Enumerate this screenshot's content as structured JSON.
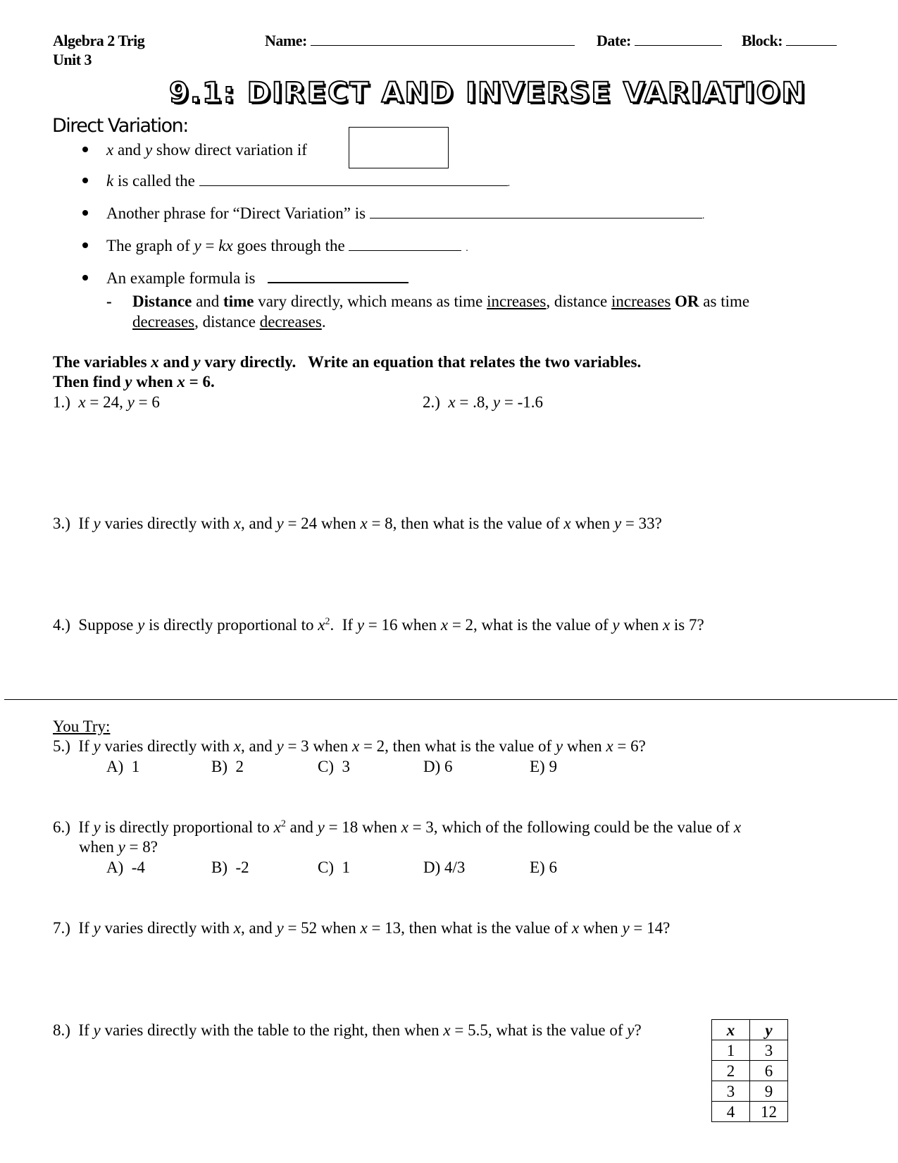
{
  "header": {
    "course": "Algebra 2 Trig",
    "unit": "Unit 3",
    "name_label": "Name:",
    "date_label": "Date:",
    "block_label": "Block:"
  },
  "title": "9.1: DIRECT AND INVERSE VARIATION",
  "direct_variation": {
    "heading": "Direct Variation:",
    "bullets": [
      {
        "pre_var1": "x",
        "text1": " and ",
        "pre_var2": "y",
        "text2": " show direct variation if"
      },
      {
        "var": "k",
        "text": " is called the",
        "end": "."
      },
      {
        "text": "Another phrase for “Direct Variation” is",
        "end": "."
      },
      {
        "text1": "The graph of ",
        "eq": "y",
        "eq_mid": " = ",
        "eq2": "kx",
        "text2": " goes through the",
        "end": "."
      },
      {
        "text": "An example formula is"
      }
    ],
    "sub_bullet": {
      "dash": "-",
      "w1": "Distance",
      "t1": " and ",
      "w2": "time",
      "t2": " vary directly, which means as time ",
      "u1": "increases",
      "t3": ", distance ",
      "u2": "increases",
      "t4": " ",
      "w3": "OR",
      "t5": " as time",
      "u3": "decreases",
      "t6": ", distance ",
      "u4": "decreases",
      "t7": "."
    }
  },
  "instructions": {
    "line1_a": "The variables ",
    "line1_x": "x",
    "line1_b": " and ",
    "line1_y": "y",
    "line1_c": " vary directly.   Write an equation that relates the two variables.",
    "line2_a": "Then find ",
    "line2_y": "y",
    "line2_b": " when ",
    "line2_x": "x",
    "line2_c": " = 6."
  },
  "problems": {
    "p1": {
      "num": "1.)",
      "x": "x",
      "xv": " = 24, ",
      "y": "y",
      "yv": " = 6"
    },
    "p2": {
      "num": "2.)",
      "x": "x",
      "xv": " = .8, ",
      "y": "y",
      "yv": " = -1.6"
    },
    "p3": {
      "num": "3.)",
      "a": "If ",
      "y1": "y",
      "b": " varies directly with ",
      "x1": "x",
      "c": ", and ",
      "y2": "y",
      "d": " = 24 when ",
      "x2": "x",
      "e": " = 8, then what is the value of ",
      "x3": "x",
      "f": " when ",
      "y3": "y",
      "g": " = 33?"
    },
    "p4": {
      "num": "4.)",
      "a": "Suppose ",
      "y1": "y",
      "b": " is directly proportional to ",
      "x1": "x",
      "sup": "2",
      "c": ".  If ",
      "y2": "y",
      "d": " = 16 when ",
      "x2": "x",
      "e": " = 2, what is the value of ",
      "y3": "y",
      "f": " when ",
      "x3": "x",
      "g": " is 7?"
    }
  },
  "you_try": {
    "heading": "You Try:",
    "p5": {
      "num": "5.)",
      "a": "If ",
      "y1": "y",
      "b": " varies directly with ",
      "x1": "x",
      "c": ", and ",
      "y2": "y",
      "d": " = 3 when ",
      "x2": "x",
      "e": " = 2, then what is the value of ",
      "y3": "y",
      "f": " when ",
      "x3": "x",
      "g": " = 6?",
      "choices": [
        "A)  1",
        "B)  2",
        "C)  3",
        "D) 6",
        "E) 9"
      ]
    },
    "p6": {
      "num": "6.)",
      "a": "If ",
      "y1": "y",
      "b": " is directly proportional to ",
      "x1": "x",
      "sup": "2",
      "c": " and ",
      "y2": "y",
      "d": " = 18 when ",
      "x2": "x",
      "e": " = 3, which of the following could be the value of ",
      "x3": "x",
      "l2a": "when ",
      "y3": "y",
      "l2b": " = 8?",
      "choices": [
        "A)  -4",
        "B)  -2",
        "C)  1",
        "D) 4/3",
        "E) 6"
      ]
    },
    "p7": {
      "num": "7.)",
      "a": "If ",
      "y1": "y",
      "b": " varies directly with ",
      "x1": "x",
      "c": ", and ",
      "y2": "y",
      "d": " = 52 when ",
      "x2": "x",
      "e": " = 13, then what is the value of ",
      "x3": "x",
      "f": " when ",
      "y3": "y",
      "g": " = 14?"
    },
    "p8": {
      "num": "8.)",
      "a": "If ",
      "y1": "y",
      "b": " varies directly with the table to the right, then when ",
      "x1": "x",
      "c": " = 5.5, what is the value of ",
      "y2": "y",
      "d": "?",
      "table": {
        "headers": [
          "x",
          "y"
        ],
        "rows": [
          [
            "1",
            "3"
          ],
          [
            "2",
            "6"
          ],
          [
            "3",
            "9"
          ],
          [
            "4",
            "12"
          ]
        ]
      }
    }
  }
}
